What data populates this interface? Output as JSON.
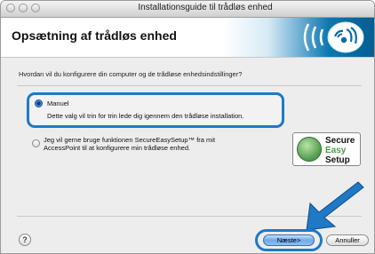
{
  "window": {
    "title": "Installationsguide til trådløs enhed"
  },
  "header": {
    "title": "Opsætning af trådløs enhed"
  },
  "question": "Hvordan vil du konfigurere din computer og de trådløse enhedsindstillinger?",
  "options": [
    {
      "label": "Manuel",
      "description": "Dette valg vil trin for trin lede dig igennem den trådløse installation.",
      "selected": true
    },
    {
      "line1": "Jeg vil gerne bruge funktionen SecureEasySetup™ fra mit",
      "line2": "AccessPoint til at konfigurere min trådløse enhed.",
      "selected": false
    }
  ],
  "logo": {
    "line1": "Secure",
    "line2": "Easy",
    "line3": "Setup"
  },
  "buttons": {
    "next": "Næste>",
    "cancel": "Annuller",
    "help": "?"
  },
  "colors": {
    "accent": "#1f79c5",
    "brand_blue": "#0b78b2",
    "logo_green": "#4f9a4a"
  },
  "icons": [
    "wireless-logo-icon",
    "help-icon",
    "pointer-arrow-icon",
    "secureeasysetup-logo-icon"
  ]
}
